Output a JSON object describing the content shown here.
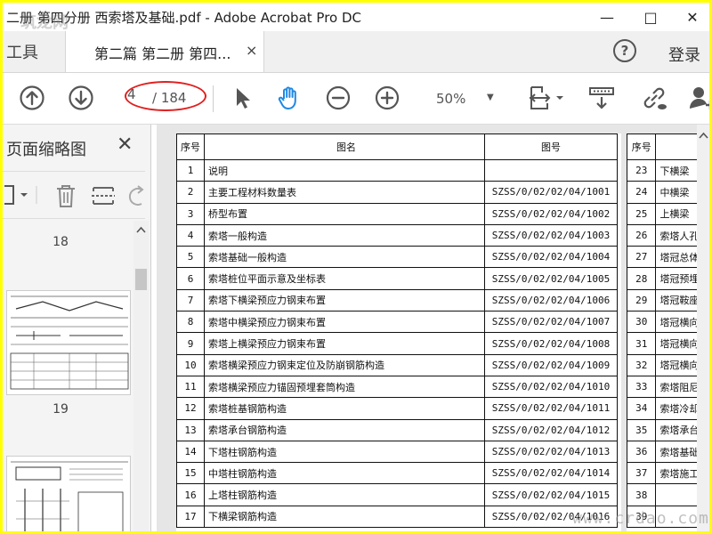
{
  "window": {
    "title": "二册 第四分册 西索塔及基础.pdf - Adobe Acrobat Pro DC",
    "minimize": "—",
    "maximize": "□",
    "close": "✕"
  },
  "tabs": {
    "tools": "工具",
    "document": "第二篇 第二册 第四...",
    "document_close": "×",
    "help": "?",
    "login": "登录"
  },
  "toolbar": {
    "current_page": "4",
    "total_pages": "/ 184",
    "zoom": "50%",
    "zoom_arrow": "▼",
    "accent_color": "#1e88e5",
    "annotation_color": "#e02020"
  },
  "left_panel": {
    "title": "页面缩略图",
    "close": "✕",
    "thumbnails": [
      "18",
      "19"
    ]
  },
  "index_table": {
    "headers": {
      "no": "序号",
      "name": "图名",
      "code": "图号"
    },
    "rows": [
      {
        "no": "1",
        "name": "说明",
        "code": ""
      },
      {
        "no": "2",
        "name": "主要工程材料数量表",
        "code": "SZSS/0/02/02/04/1001"
      },
      {
        "no": "3",
        "name": "桥型布置",
        "code": "SZSS/0/02/02/04/1002"
      },
      {
        "no": "4",
        "name": "索塔一般构造",
        "code": "SZSS/0/02/02/04/1003"
      },
      {
        "no": "5",
        "name": "索塔基础一般构造",
        "code": "SZSS/0/02/02/04/1004"
      },
      {
        "no": "6",
        "name": "索塔桩位平面示意及坐标表",
        "code": "SZSS/0/02/02/04/1005"
      },
      {
        "no": "7",
        "name": "索塔下横梁预应力钢束布置",
        "code": "SZSS/0/02/02/04/1006"
      },
      {
        "no": "8",
        "name": "索塔中横梁预应力钢束布置",
        "code": "SZSS/0/02/02/04/1007"
      },
      {
        "no": "9",
        "name": "索塔上横梁预应力钢束布置",
        "code": "SZSS/0/02/02/04/1008"
      },
      {
        "no": "10",
        "name": "索塔横梁预应力钢束定位及防崩钢筋构造",
        "code": "SZSS/0/02/02/04/1009"
      },
      {
        "no": "11",
        "name": "索塔横梁预应力锚固预埋套筒构造",
        "code": "SZSS/0/02/02/04/1010"
      },
      {
        "no": "12",
        "name": "索塔桩基钢筋构造",
        "code": "SZSS/0/02/02/04/1011"
      },
      {
        "no": "13",
        "name": "索塔承台钢筋构造",
        "code": "SZSS/0/02/02/04/1012"
      },
      {
        "no": "14",
        "name": "下塔柱钢筋构造",
        "code": "SZSS/0/02/02/04/1013"
      },
      {
        "no": "15",
        "name": "中塔柱钢筋构造",
        "code": "SZSS/0/02/02/04/1014"
      },
      {
        "no": "16",
        "name": "上塔柱钢筋构造",
        "code": "SZSS/0/02/02/04/1015"
      },
      {
        "no": "17",
        "name": "下横梁钢筋构造",
        "code": "SZSS/0/02/02/04/1016"
      }
    ]
  },
  "index_table_2": {
    "header": "序号",
    "rows": [
      {
        "no": "23",
        "name": "下横梁"
      },
      {
        "no": "24",
        "name": "中横梁"
      },
      {
        "no": "25",
        "name": "上横梁"
      },
      {
        "no": "26",
        "name": "索塔人孔"
      },
      {
        "no": "27",
        "name": "塔冠总体"
      },
      {
        "no": "28",
        "name": "塔冠预埋"
      },
      {
        "no": "29",
        "name": "塔冠鞍座"
      },
      {
        "no": "30",
        "name": "塔冠横向"
      },
      {
        "no": "31",
        "name": "塔冠横向"
      },
      {
        "no": "32",
        "name": "塔冠横向"
      },
      {
        "no": "33",
        "name": "索塔阻尼"
      },
      {
        "no": "34",
        "name": "索塔冷却"
      },
      {
        "no": "35",
        "name": "索塔承台"
      },
      {
        "no": "36",
        "name": "索塔基础"
      },
      {
        "no": "37",
        "name": "索塔施工"
      },
      {
        "no": "38",
        "name": ""
      },
      {
        "no": "39",
        "name": ""
      }
    ]
  },
  "watermarks": {
    "top_left": "筑龙网",
    "bottom_right": "www.crdao.com"
  }
}
